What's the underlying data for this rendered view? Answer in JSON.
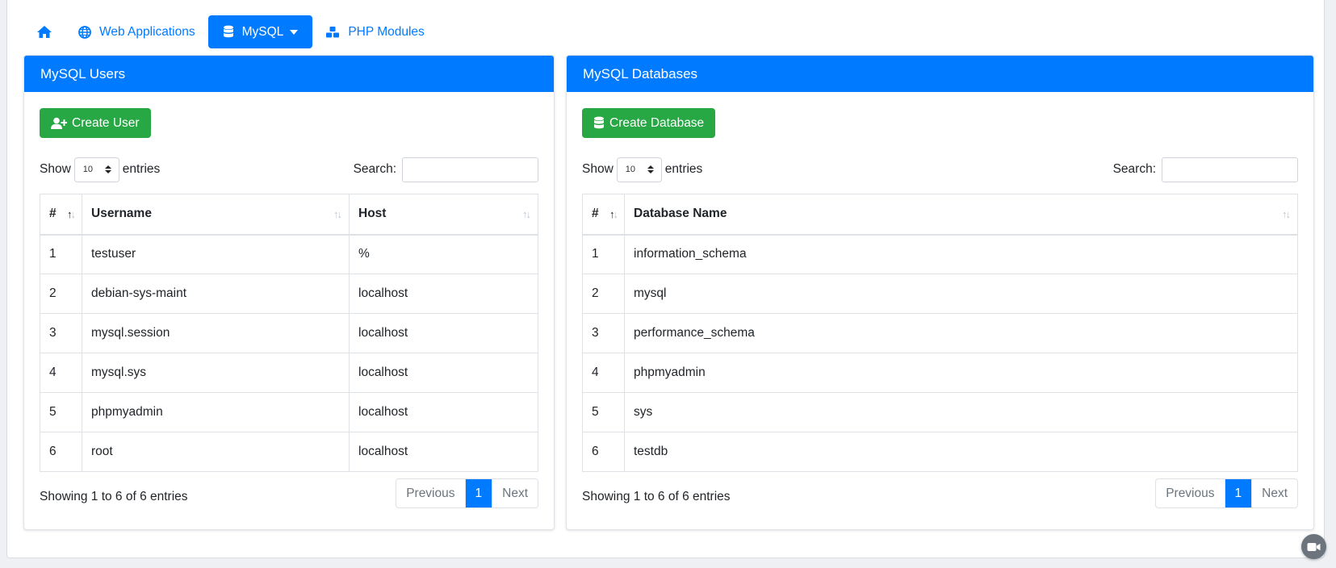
{
  "nav": {
    "home_icon": "home-icon",
    "items": [
      {
        "label": "Web Applications",
        "icon": "globe-icon"
      },
      {
        "label": "MySQL",
        "icon": "database-icon",
        "active": true
      },
      {
        "label": "PHP Modules",
        "icon": "cubes-icon"
      }
    ]
  },
  "colors": {
    "primary": "#007bff",
    "success": "#28a745"
  },
  "users_card": {
    "title": "MySQL Users",
    "create_button": "Create User",
    "show_label": "Show",
    "entries_label": "entries",
    "page_length": "10",
    "search_label": "Search:",
    "search_value": "",
    "columns": [
      "#",
      "Username",
      "Host"
    ],
    "rows": [
      [
        "1",
        "testuser",
        "%"
      ],
      [
        "2",
        "debian-sys-maint",
        "localhost"
      ],
      [
        "3",
        "mysql.session",
        "localhost"
      ],
      [
        "4",
        "mysql.sys",
        "localhost"
      ],
      [
        "5",
        "phpmyadmin",
        "localhost"
      ],
      [
        "6",
        "root",
        "localhost"
      ]
    ],
    "info": "Showing 1 to 6 of 6 entries",
    "pager": {
      "previous": "Previous",
      "current": "1",
      "next": "Next"
    }
  },
  "db_card": {
    "title": "MySQL Databases",
    "create_button": "Create Database",
    "show_label": "Show",
    "entries_label": "entries",
    "page_length": "10",
    "search_label": "Search:",
    "search_value": "",
    "columns": [
      "#",
      "Database Name"
    ],
    "rows": [
      [
        "1",
        "information_schema"
      ],
      [
        "2",
        "mysql"
      ],
      [
        "3",
        "performance_schema"
      ],
      [
        "4",
        "phpmyadmin"
      ],
      [
        "5",
        "sys"
      ],
      [
        "6",
        "testdb"
      ]
    ],
    "info": "Showing 1 to 6 of 6 entries",
    "pager": {
      "previous": "Previous",
      "current": "1",
      "next": "Next"
    }
  }
}
